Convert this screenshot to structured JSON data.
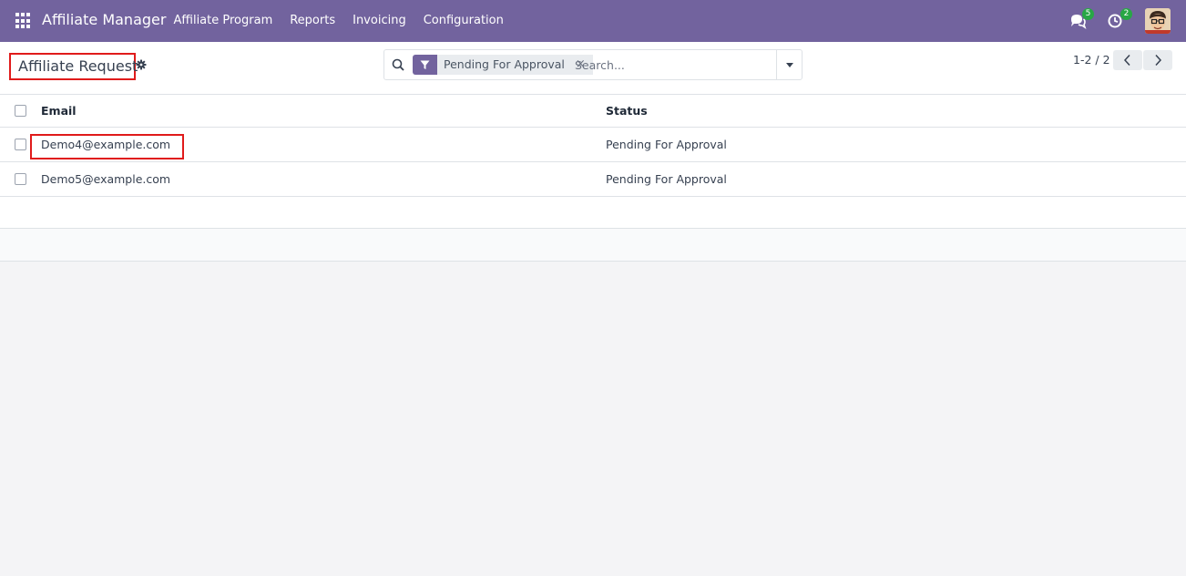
{
  "navbar": {
    "app_name": "Affiliate Manager",
    "menu": [
      {
        "label": "Affiliate Program"
      },
      {
        "label": "Reports"
      },
      {
        "label": "Invoicing"
      },
      {
        "label": "Configuration"
      }
    ],
    "messages_badge": "5",
    "activities_badge": "2",
    "accent_color": "#72639e"
  },
  "control_panel": {
    "title": "Affiliate Request",
    "search": {
      "facet_value": "Pending For Approval",
      "facet_remove": "×",
      "placeholder": "Search..."
    },
    "pager": {
      "value": "1-2 / 2"
    }
  },
  "list": {
    "columns": {
      "email": "Email",
      "status": "Status"
    },
    "rows": [
      {
        "email": "Demo4@example.com",
        "status": "Pending For Approval"
      },
      {
        "email": "Demo5@example.com",
        "status": "Pending For Approval"
      }
    ]
  }
}
